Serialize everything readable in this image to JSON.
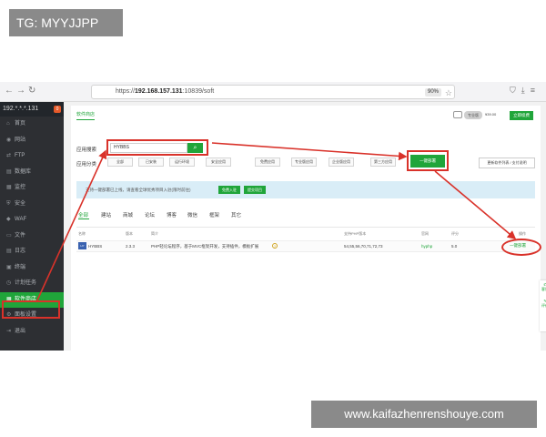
{
  "watermark": {
    "top": "TG: MYYJJPP",
    "bottom": "www.kaifazhenrenshouye.com"
  },
  "browser": {
    "url_prefix": "https://",
    "url_host": "192.168.157.131",
    "url_rest": ":10839/soft",
    "zoom": "90%",
    "nav_back": "←",
    "nav_forward": "→",
    "nav_reload": "↻"
  },
  "sidebar": {
    "server": "192.*.*.*.131",
    "badge": "0",
    "items": [
      {
        "icon": "⌂",
        "label": "首页"
      },
      {
        "icon": "◉",
        "label": "网站"
      },
      {
        "icon": "⇄",
        "label": "FTP"
      },
      {
        "icon": "▤",
        "label": "数据库"
      },
      {
        "icon": "▦",
        "label": "监控"
      },
      {
        "icon": "⛨",
        "label": "安全"
      },
      {
        "icon": "◆",
        "label": "WAF"
      },
      {
        "icon": "▭",
        "label": "文件"
      },
      {
        "icon": "▤",
        "label": "日志"
      },
      {
        "icon": "▣",
        "label": "终端"
      },
      {
        "icon": "◷",
        "label": "计划任务"
      },
      {
        "icon": "▦",
        "label": "软件商店"
      },
      {
        "icon": "⚙",
        "label": "面板设置"
      },
      {
        "icon": "⇥",
        "label": "退出"
      }
    ]
  },
  "panel": {
    "tab_store": "软件商店",
    "vip_label": "专业版",
    "vip_price": "¥39.00",
    "renew_btn": "立即续费",
    "search_label": "应用搜索",
    "search_value": "HYBBS",
    "category_label": "应用分类",
    "categories": [
      "全部",
      "已安装",
      "运行环境",
      "安全应用",
      "免费应用",
      "专业版应用",
      "企业版应用",
      "第三方应用"
    ],
    "one_click_btn": "一键部署",
    "purchased_btn": "更新软件列表 / 支付说明",
    "notice_text": "支持一键部署已上线，请查看全球优秀项目入驻(限时前往)",
    "notice_btn1": "免费入驻",
    "notice_btn2": "提交项目",
    "subtabs": [
      "全部",
      "建站",
      "商城",
      "论坛",
      "博客",
      "微信",
      "框架",
      "其它"
    ],
    "table": {
      "headers": [
        "名称",
        "版本",
        "简介",
        "支持PHP版本",
        "官网",
        "评分",
        "操作"
      ],
      "rows": [
        {
          "icon": "HY",
          "name": "HYBBS",
          "version": "2.3.3",
          "desc": "PHP轻论坛程序，基于MVC框架开发，支持插件，模板扩展",
          "php": "54,55,56,70,71,72,73",
          "site": "hyphp",
          "score": "5.0",
          "action": "一键部署"
        }
      ]
    }
  },
  "float_widget": {
    "top": "客服",
    "bottom": "评价"
  },
  "colors": {
    "accent": "#20a53a",
    "annotation": "#d9322a",
    "sidebar_bg": "#2d2f33"
  }
}
